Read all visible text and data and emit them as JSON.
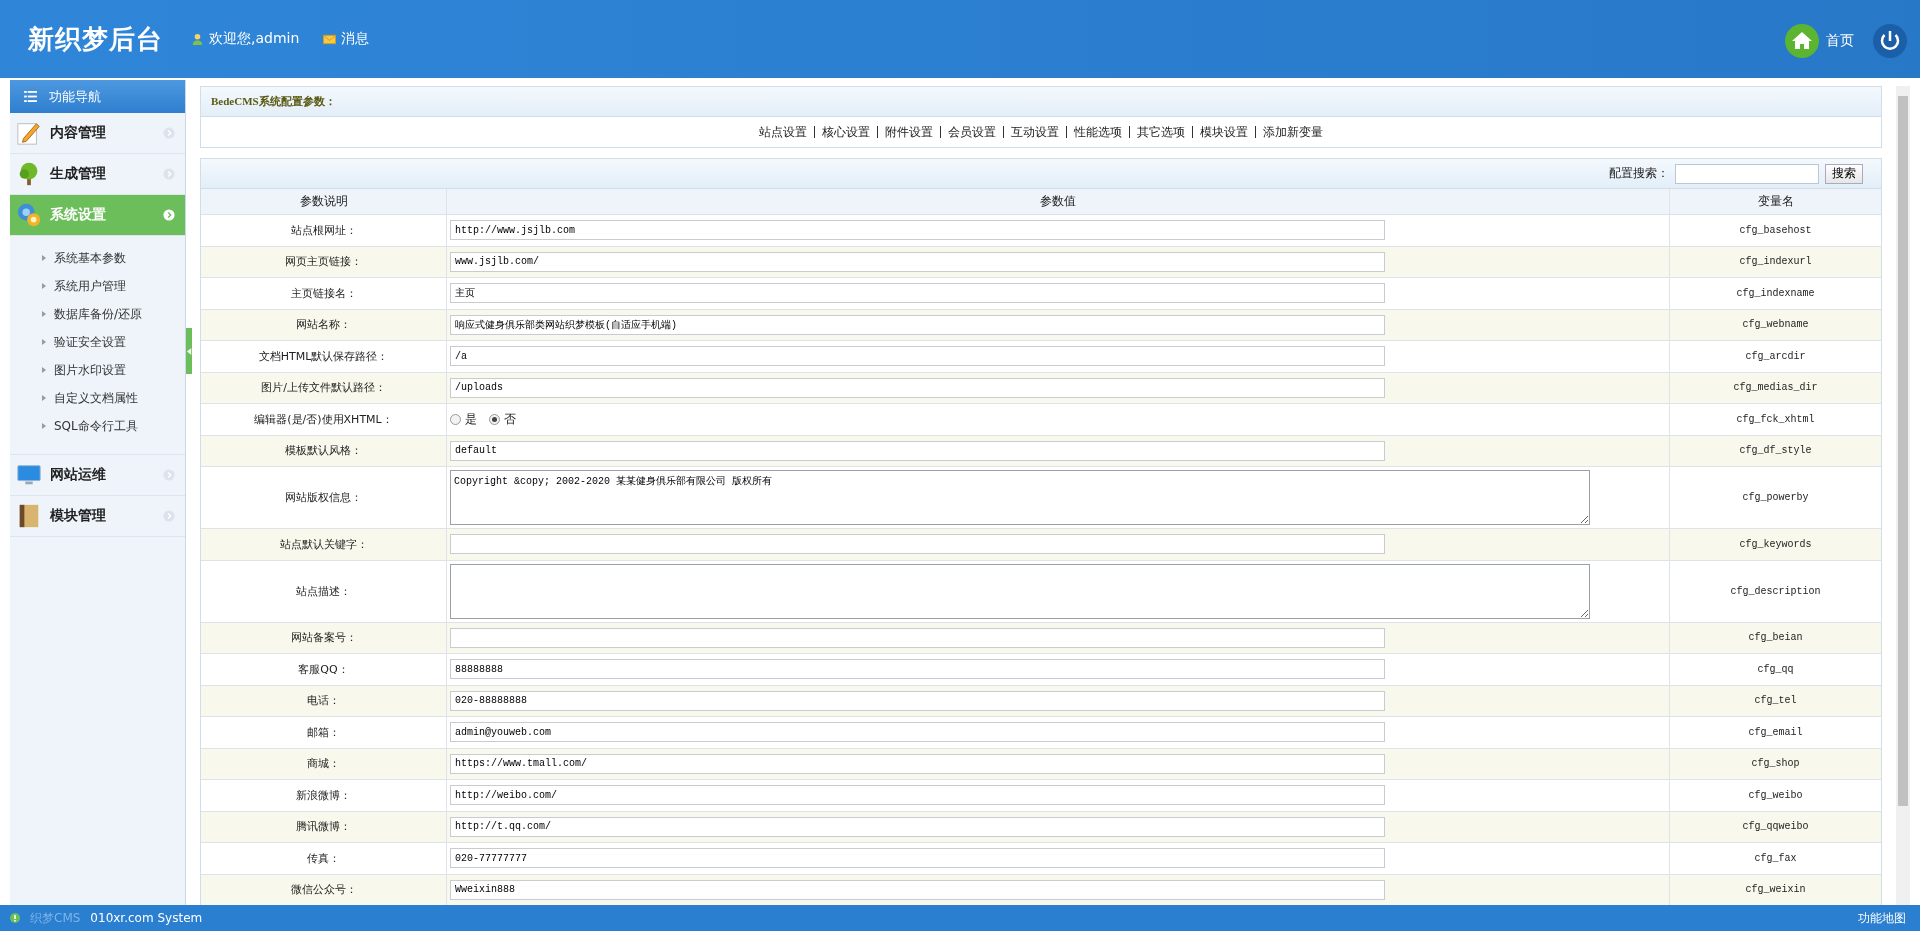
{
  "header": {
    "logo": "新织梦后台",
    "welcome": "欢迎您,admin",
    "messages": "消息",
    "home": "首页"
  },
  "sidebar": {
    "title": "功能导航",
    "groups": [
      {
        "label": "内容管理",
        "expanded": false
      },
      {
        "label": "生成管理",
        "expanded": false
      },
      {
        "label": "系统设置",
        "expanded": true,
        "items": [
          "系统基本参数",
          "系统用户管理",
          "数据库备份/还原",
          "验证安全设置",
          "图片水印设置",
          "自定义文档属性",
          "SQL命令行工具"
        ]
      },
      {
        "label": "网站运维",
        "expanded": false
      },
      {
        "label": "模块管理",
        "expanded": false
      }
    ]
  },
  "config": {
    "title": "BedeCMS系统配置参数：",
    "tabs": [
      "站点设置",
      "核心设置",
      "附件设置",
      "会员设置",
      "互动设置",
      "性能选项",
      "其它选项",
      "模块设置",
      "添加新变量"
    ]
  },
  "table": {
    "search_label": "配置搜索：",
    "search_button": "搜索",
    "columns": [
      "参数说明",
      "参数值",
      "变量名"
    ],
    "rows": [
      {
        "kind": "text",
        "label": "站点根网址：",
        "value": "http://www.jsjlb.com",
        "name": "cfg_basehost"
      },
      {
        "kind": "text",
        "label": "网页主页链接：",
        "value": "www.jsjlb.com/",
        "name": "cfg_indexurl"
      },
      {
        "kind": "text",
        "label": "主页链接名：",
        "value": "主页",
        "name": "cfg_indexname"
      },
      {
        "kind": "text",
        "label": "网站名称：",
        "value": "响应式健身俱乐部类网站织梦模板(自适应手机端)",
        "name": "cfg_webname"
      },
      {
        "kind": "text",
        "label": "文档HTML默认保存路径：",
        "value": "/a",
        "name": "cfg_arcdir"
      },
      {
        "kind": "text",
        "label": "图片/上传文件默认路径：",
        "value": "/uploads",
        "name": "cfg_medias_dir"
      },
      {
        "kind": "radio",
        "label": "编辑器(是/否)使用XHTML：",
        "options": [
          {
            "label": "是",
            "selected": false
          },
          {
            "label": "否",
            "selected": true
          }
        ],
        "name": "cfg_fck_xhtml"
      },
      {
        "kind": "text",
        "label": "模板默认风格：",
        "value": "default",
        "name": "cfg_df_style"
      },
      {
        "kind": "textarea",
        "label": "网站版权信息：",
        "value": "Copyright &copy; 2002-2020 某某健身俱乐部有限公司 版权所有",
        "name": "cfg_powerby"
      },
      {
        "kind": "text",
        "label": "站点默认关键字：",
        "name": "cfg_keywords"
      },
      {
        "kind": "textarea",
        "label": "站点描述：",
        "name": "cfg_description"
      },
      {
        "kind": "text",
        "label": "网站备案号：",
        "name": "cfg_beian"
      },
      {
        "kind": "text",
        "label": "客服QQ：",
        "value": "88888888",
        "name": "cfg_qq"
      },
      {
        "kind": "text",
        "label": "电话：",
        "value": "020-88888888",
        "name": "cfg_tel"
      },
      {
        "kind": "text",
        "label": "邮箱：",
        "value": "admin@youweb.com",
        "name": "cfg_email"
      },
      {
        "kind": "text",
        "label": "商城：",
        "value": "https://www.tmall.com/",
        "name": "cfg_shop"
      },
      {
        "kind": "text",
        "label": "新浪微博：",
        "value": "http://weibo.com/",
        "name": "cfg_weibo"
      },
      {
        "kind": "text",
        "label": "腾讯微博：",
        "value": "http://t.qq.com/",
        "name": "cfg_qqweibo"
      },
      {
        "kind": "text",
        "label": "传真：",
        "value": "020-77777777",
        "name": "cfg_fax"
      },
      {
        "kind": "text",
        "label": "微信公众号：",
        "value": "Wweixin888",
        "name": "cfg_weixin"
      }
    ]
  },
  "footer": {
    "brand": "织梦CMS",
    "system": "010xr.com System",
    "sitemap": "功能地图"
  }
}
